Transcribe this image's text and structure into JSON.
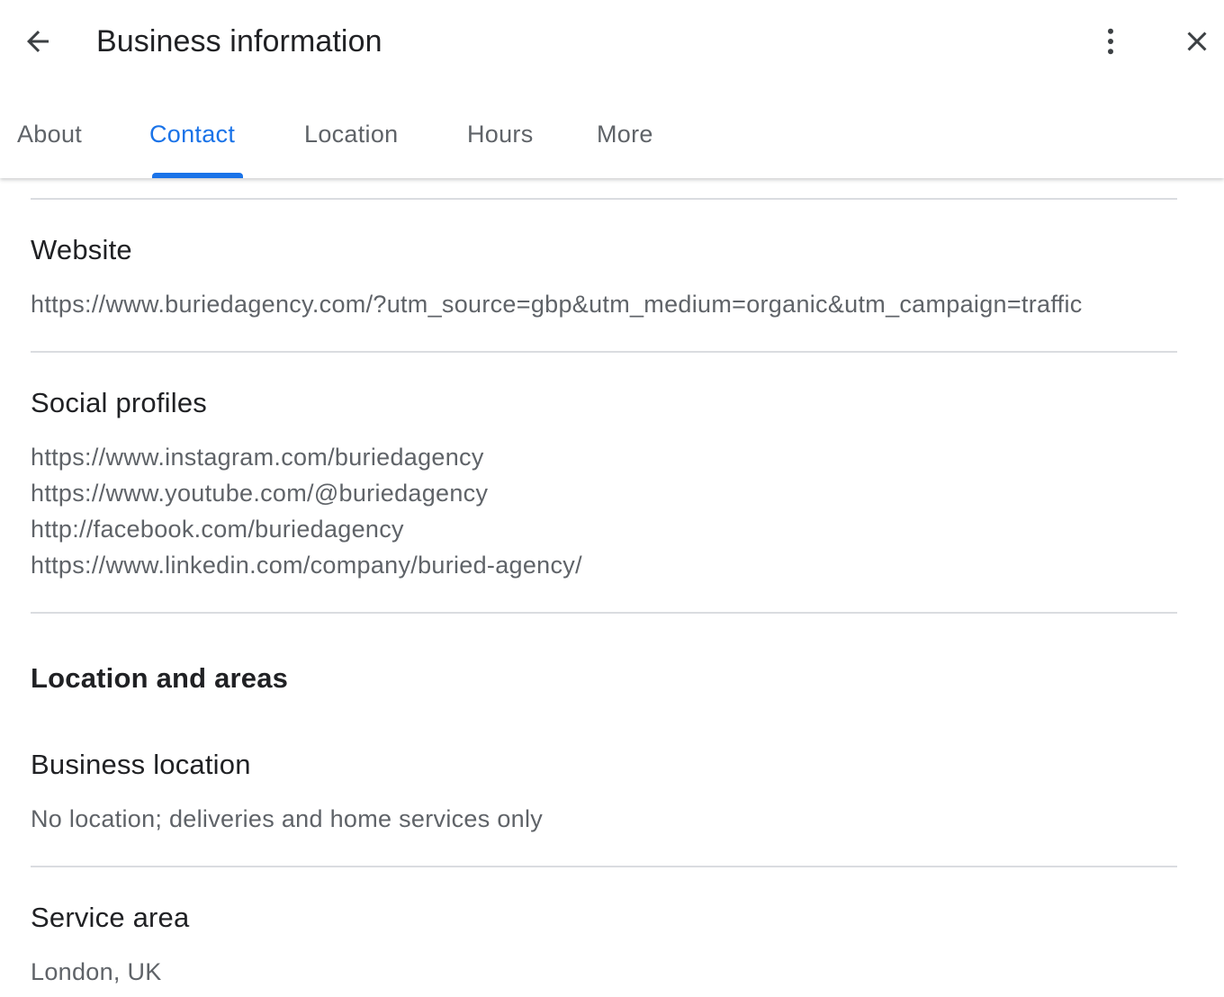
{
  "header": {
    "title": "Business information",
    "back_icon": "arrow-back-icon",
    "menu_icon": "more-vert-icon",
    "close_icon": "close-icon"
  },
  "tabs": [
    {
      "label": "About",
      "active": false
    },
    {
      "label": "Contact",
      "active": true
    },
    {
      "label": "Location",
      "active": false
    },
    {
      "label": "Hours",
      "active": false
    },
    {
      "label": "More",
      "active": false
    }
  ],
  "contact": {
    "website": {
      "label": "Website",
      "value": "https://www.buriedagency.com/?utm_source=gbp&utm_medium=organic&utm_campaign=traffic"
    },
    "social": {
      "label": "Social profiles",
      "values": [
        "https://www.instagram.com/buriedagency",
        "https://www.youtube.com/@buriedagency",
        "http://facebook.com/buriedagency",
        "https://www.linkedin.com/company/buried-agency/"
      ]
    }
  },
  "location_section": {
    "title": "Location and areas",
    "business_location": {
      "label": "Business location",
      "value": "No location; deliveries and home services only"
    },
    "service_area": {
      "label": "Service area",
      "value": "London, UK"
    }
  },
  "colors": {
    "accent": "#1a73e8",
    "text_primary": "#202124",
    "text_secondary": "#5f6368",
    "divider": "#dadce0"
  }
}
